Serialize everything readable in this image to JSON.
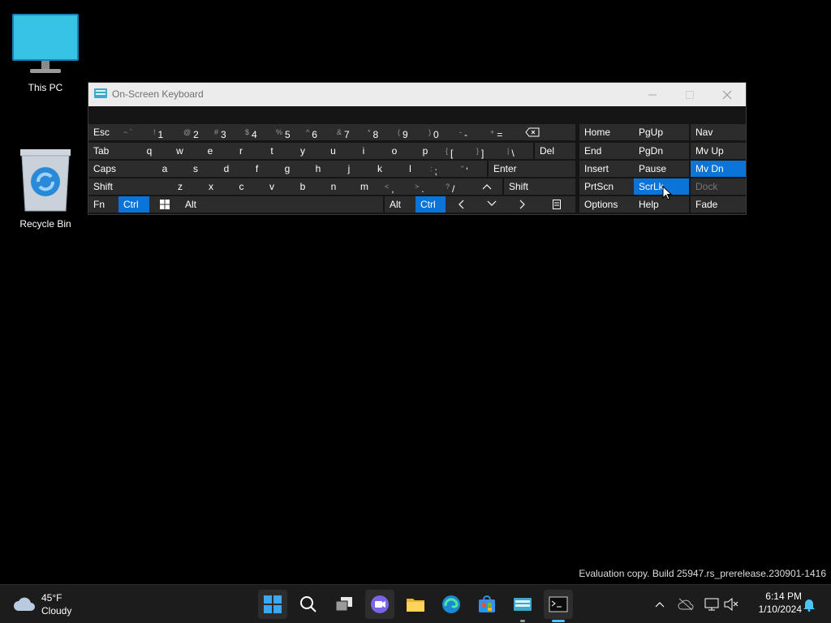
{
  "desktop": {
    "this_pc": "This PC",
    "recycle_bin": "Recycle Bin"
  },
  "window": {
    "title": "On-Screen Keyboard"
  },
  "keyboard": {
    "row1": {
      "esc": "Esc",
      "tilde": [
        "~ `",
        ""
      ],
      "one": [
        "!",
        "1"
      ],
      "two": [
        "@",
        "2"
      ],
      "three": [
        "#",
        "3"
      ],
      "four": [
        "$",
        "4"
      ],
      "five": [
        "%",
        "5"
      ],
      "six": [
        "^",
        "6"
      ],
      "seven": [
        "&",
        "7"
      ],
      "eight": [
        "*",
        "8"
      ],
      "nine": [
        "(",
        "9"
      ],
      "zero": [
        ")",
        "0"
      ],
      "minus": [
        "-",
        "-"
      ],
      "equals": [
        "+",
        "="
      ]
    },
    "row2": {
      "tab": "Tab",
      "letters": [
        "q",
        "w",
        "e",
        "r",
        "t",
        "y",
        "u",
        "i",
        "o",
        "p"
      ],
      "bracket_open": [
        "{",
        "["
      ],
      "bracket_close": [
        "}",
        "]"
      ],
      "backslash": [
        "|",
        "\\"
      ],
      "del": "Del"
    },
    "row3": {
      "caps": "Caps",
      "letters": [
        "a",
        "s",
        "d",
        "f",
        "g",
        "h",
        "j",
        "k",
        "l"
      ],
      "semicolon": [
        ":",
        ";"
      ],
      "quote": [
        "\"",
        "'"
      ],
      "enter": "Enter"
    },
    "row4": {
      "shift_left": "Shift",
      "letters": [
        "z",
        "x",
        "c",
        "v",
        "b",
        "n",
        "m"
      ],
      "comma": [
        "<",
        ","
      ],
      "period": [
        ">",
        "."
      ],
      "slash": [
        "?",
        "/"
      ],
      "shift_right": "Shift"
    },
    "row5": {
      "fn": "Fn",
      "ctrl_left": "Ctrl",
      "alt_left": "Alt",
      "alt_right": "Alt",
      "ctrl_right": "Ctrl"
    },
    "nav": {
      "home": "Home",
      "pgup": "PgUp",
      "nav": "Nav",
      "end": "End",
      "pgdn": "PgDn",
      "mvup": "Mv Up",
      "insert": "Insert",
      "pause": "Pause",
      "mvdn": "Mv Dn",
      "prtscn": "PrtScn",
      "scrlk": "ScrLk",
      "dock": "Dock",
      "options": "Options",
      "help": "Help",
      "fade": "Fade"
    }
  },
  "taskbar": {
    "weather_temp": "45°F",
    "weather_cond": "Cloudy",
    "time": "6:14 PM",
    "date": "1/10/2024"
  },
  "watermark": "Evaluation copy. Build 25947.rs_prerelease.230901-1416",
  "colors": {
    "accent": "#0a74d8",
    "key": "#2c2c2c",
    "keyboard_bg": "#151515"
  }
}
